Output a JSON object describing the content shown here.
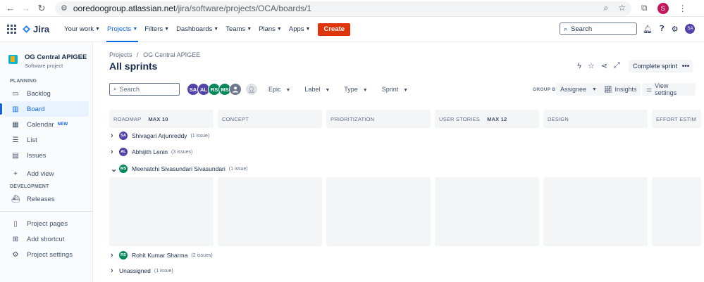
{
  "browser": {
    "url_host": "ooredoogroup.atlassian.net",
    "url_path": "/jira/software/projects/OCA/boards/1",
    "profile_initial": "S"
  },
  "topnav": {
    "product": "Jira",
    "menu": [
      {
        "label": "Your work",
        "active": false
      },
      {
        "label": "Projects",
        "active": true
      },
      {
        "label": "Filters",
        "active": false
      },
      {
        "label": "Dashboards",
        "active": false
      },
      {
        "label": "Teams",
        "active": false
      },
      {
        "label": "Plans",
        "active": false
      },
      {
        "label": "Apps",
        "active": false
      }
    ],
    "create_label": "Create",
    "search_placeholder": "Search",
    "user_initials": "SA"
  },
  "sidebar": {
    "project_name": "OG Central APIGEE",
    "project_type": "Software project",
    "planning_head": "PLANNING",
    "planning_items": [
      {
        "label": "Backlog",
        "icon": "backlog-icon",
        "glyph": "▭"
      },
      {
        "label": "Board",
        "icon": "board-icon",
        "glyph": "▥",
        "active": true
      },
      {
        "label": "Calendar",
        "icon": "calendar-icon",
        "glyph": "▦",
        "badge": "NEW"
      },
      {
        "label": "List",
        "icon": "list-icon",
        "glyph": "☰"
      },
      {
        "label": "Issues",
        "icon": "issues-icon",
        "glyph": "▤"
      }
    ],
    "add_view": "Add view",
    "development_head": "DEVELOPMENT",
    "releases": "Releases",
    "project_pages": "Project pages",
    "add_shortcut": "Add shortcut",
    "project_settings": "Project settings"
  },
  "main": {
    "breadcrumb": [
      "Projects",
      "/",
      "OG Central APIGEE"
    ],
    "title": "All sprints",
    "complete_sprint": "Complete sprint",
    "search_placeholder": "Search",
    "avatars": [
      {
        "initials": "SA",
        "color": "#5243aa"
      },
      {
        "initials": "AL",
        "color": "#5243aa"
      },
      {
        "initials": "RS",
        "color": "#00875a"
      },
      {
        "initials": "MS",
        "color": "#00875a"
      }
    ],
    "filters": [
      "Epic",
      "Label",
      "Type",
      "Sprint"
    ],
    "group_by_label": "GROUP BY",
    "group_by_value": "Assignee",
    "insights": "Insights",
    "view_settings": "View settings",
    "columns": [
      {
        "name": "ROADMAP",
        "max": "MAX 10"
      },
      {
        "name": "CONCEPT",
        "max": ""
      },
      {
        "name": "PRIORITIZATION",
        "max": ""
      },
      {
        "name": "USER STORIES",
        "max": "MAX 12"
      },
      {
        "name": "DESIGN",
        "max": ""
      },
      {
        "name": "EFFORT ESTIM",
        "max": ""
      }
    ],
    "swimlanes": [
      {
        "name": "Shivagari Arjunreddy",
        "count": "(1 issue)",
        "initials": "SA",
        "color": "#5243aa",
        "expanded": false
      },
      {
        "name": "Abhijith Lenin",
        "count": "(3 issues)",
        "initials": "AL",
        "color": "#5243aa",
        "expanded": false
      },
      {
        "name": "Meenatchi Sivasundari Sivasundari",
        "count": "(1 issue)",
        "initials": "MS",
        "color": "#00875a",
        "expanded": true
      },
      {
        "name": "Rohit Kumar Sharma",
        "count": "(2 issues)",
        "initials": "RS",
        "color": "#00875a",
        "expanded": false
      },
      {
        "name": "Unassigned",
        "count": "(1 issue)",
        "initials": "",
        "color": "",
        "expanded": false
      }
    ]
  }
}
